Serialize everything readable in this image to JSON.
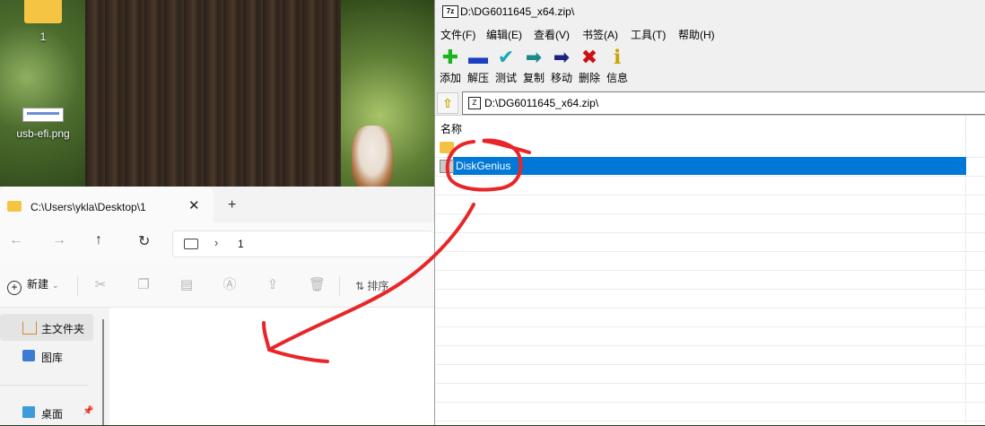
{
  "desktop": {
    "icons": [
      {
        "label": "1",
        "icon": "folder-icon"
      },
      {
        "label": "usb-efi.png",
        "icon": "image-file-icon"
      }
    ]
  },
  "explorer": {
    "tab_title": "C:\\Users\\ykla\\Desktop\\1",
    "close_glyph": "✕",
    "new_tab_glyph": "+",
    "breadcrumb": "1",
    "breadcrumb_sep": "›",
    "nav": {
      "back": "←",
      "forward": "→",
      "up": "↑",
      "refresh": "↻"
    },
    "new_label": "新建",
    "sort_label": "排序",
    "sidebar": [
      {
        "label": "主文件夹",
        "icon": "home-icon"
      },
      {
        "label": "图库",
        "icon": "gallery-icon"
      },
      {
        "label": "桌面",
        "icon": "desktop-icon"
      }
    ]
  },
  "zip": {
    "title": "D:\\DG6011645_x64.zip\\",
    "logo_text": "7z",
    "menu": [
      "文件(F)",
      "编辑(E)",
      "查看(V)",
      "书签(A)",
      "工具(T)",
      "帮助(H)"
    ],
    "toolbar": [
      {
        "label": "添加",
        "glyph": "✚",
        "color": "#1bb21b",
        "icon": "add-icon"
      },
      {
        "label": "解压",
        "glyph": "▬",
        "color": "#1c3fbf",
        "icon": "extract-icon"
      },
      {
        "label": "测试",
        "glyph": "✔",
        "color": "#18a9b8",
        "icon": "test-icon"
      },
      {
        "label": "复制",
        "glyph": "➡",
        "color": "#1a8a8a",
        "icon": "copy-icon"
      },
      {
        "label": "移动",
        "glyph": "➡",
        "color": "#1a237e",
        "icon": "move-icon"
      },
      {
        "label": "删除",
        "glyph": "✖",
        "color": "#d01010",
        "icon": "delete-icon"
      },
      {
        "label": "信息",
        "glyph": "ℹ",
        "color": "#c9a400",
        "icon": "info-icon"
      }
    ],
    "path": "D:\\DG6011645_x64.zip\\",
    "column_name": "名称",
    "rows": [
      {
        "name": "",
        "type": "parent-folder"
      },
      {
        "name": "DiskGenius",
        "type": "folder",
        "selected": true
      }
    ]
  },
  "annotation": {
    "color": "#e8262a",
    "description": "red freehand circle around DiskGenius with arrow pointing into Explorer folder"
  }
}
